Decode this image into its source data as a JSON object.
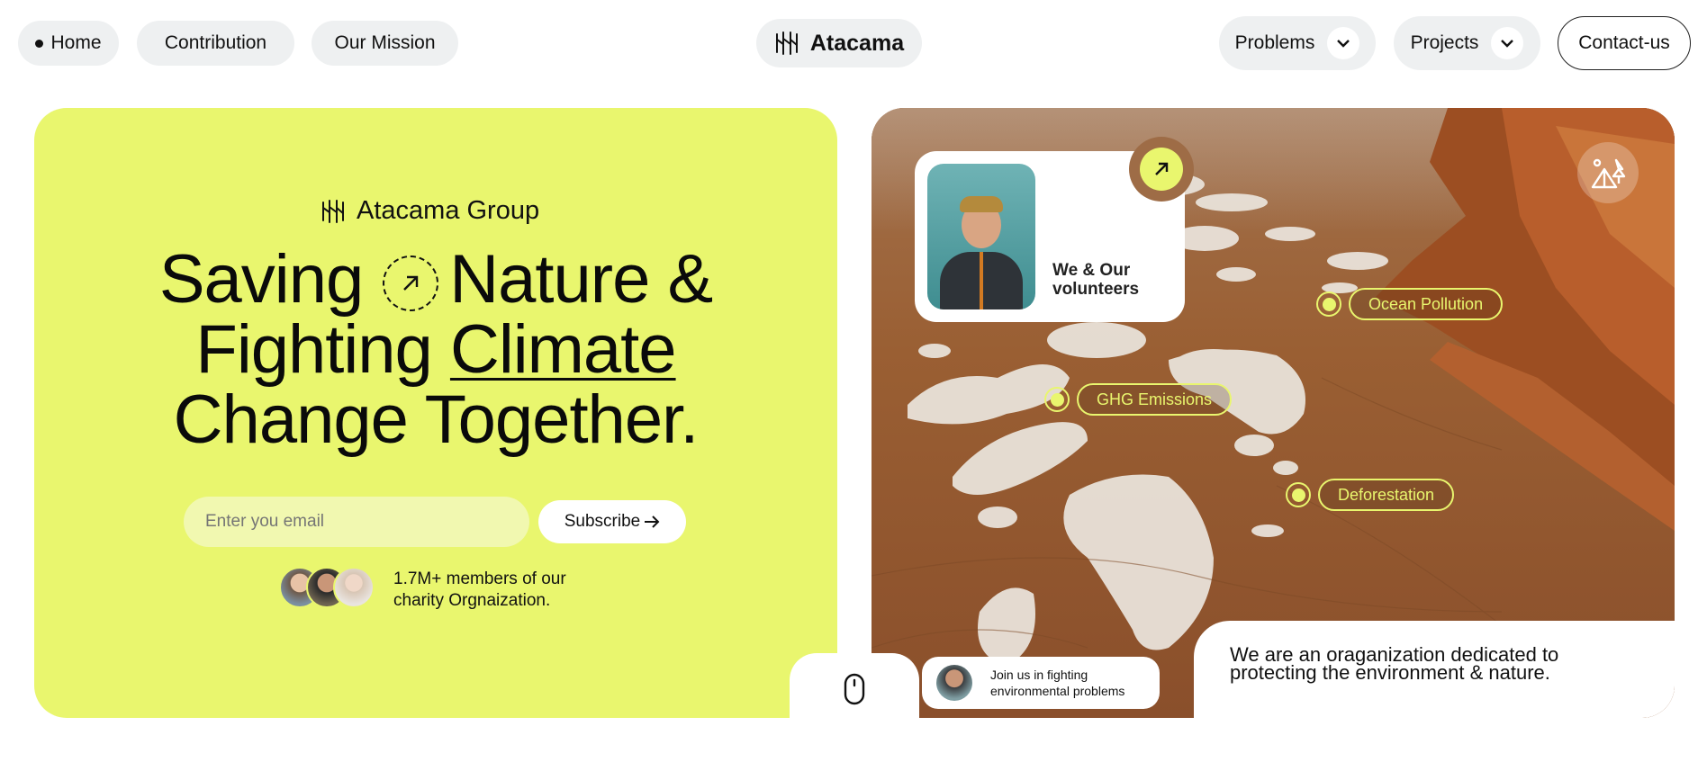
{
  "nav": {
    "home": "Home",
    "contribution": "Contribution",
    "mission": "Our Mission",
    "brand": "Atacama",
    "problems": "Problems",
    "projects": "Projects",
    "contact": "Contact-us"
  },
  "hero": {
    "group": "Atacama Group",
    "line1a": "Saving",
    "line1b": "Nature &",
    "line2a": "Fighting",
    "line2b": "Climate",
    "line3": "Change Together.",
    "email_placeholder": "Enter you email",
    "subscribe": "Subscribe",
    "members_line1": "1.7M+ members of our",
    "members_line2": "charity Orgnaization."
  },
  "panel": {
    "volunteers_line1": "We & Our",
    "volunteers_line2": "volunteers",
    "tags": [
      "Ocean Pollution",
      "GHG Emissions",
      "Deforestation"
    ],
    "join_line1": "Join us in fighting",
    "join_line2": "environmental problems",
    "about_line1": "We are an oraganization dedicated to",
    "about_line2": "protecting the environment & nature."
  },
  "colors": {
    "accent": "#e9f66e",
    "nav_pill": "#eef0f1",
    "terrain": "#9a5f33"
  },
  "icons": [
    "bullet-dot-icon",
    "atacama-logo-icon",
    "chevron-down-icon",
    "arrow-up-right-icon",
    "arrow-right-icon",
    "camp-tent-icon",
    "mouse-scroll-icon"
  ]
}
